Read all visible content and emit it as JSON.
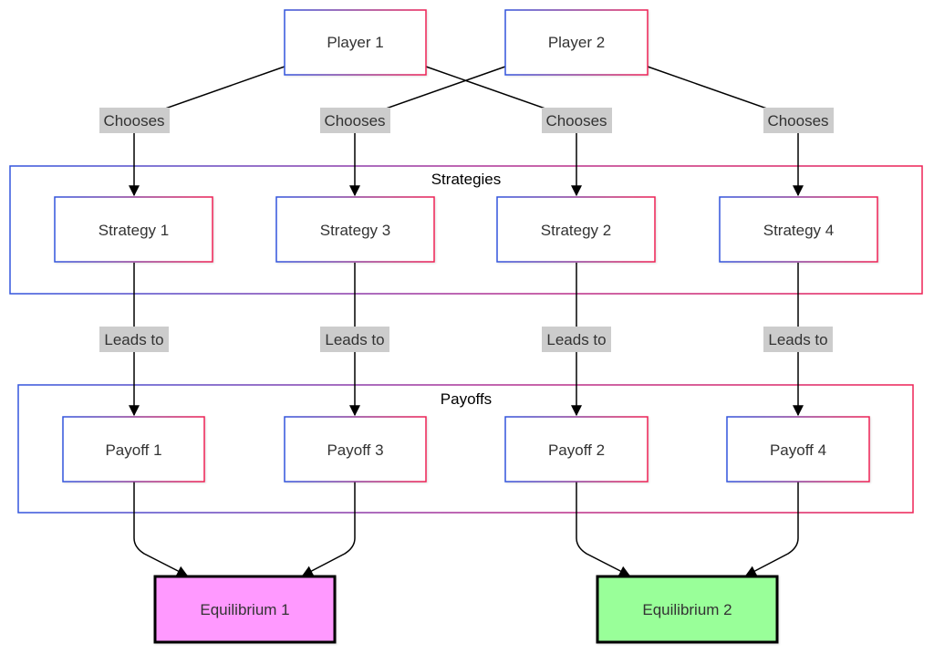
{
  "diagram": {
    "type": "flowchart",
    "colors": {
      "node_border_start": "#3355dd",
      "node_border_end": "#ee2255",
      "edge": "#000000",
      "edge_label_bg": "#cccccc",
      "equilibrium_1_fill": "#ff99ff",
      "equilibrium_2_fill": "#99ff99",
      "equilibrium_border": "#000000"
    },
    "players": [
      {
        "id": "p1",
        "label": "Player 1"
      },
      {
        "id": "p2",
        "label": "Player 2"
      }
    ],
    "clusters": {
      "strategies": {
        "title": "Strategies",
        "nodes": [
          {
            "id": "s1",
            "label": "Strategy 1"
          },
          {
            "id": "s3",
            "label": "Strategy 3"
          },
          {
            "id": "s2",
            "label": "Strategy 2"
          },
          {
            "id": "s4",
            "label": "Strategy 4"
          }
        ]
      },
      "payoffs": {
        "title": "Payoffs",
        "nodes": [
          {
            "id": "pay1",
            "label": "Payoff 1"
          },
          {
            "id": "pay3",
            "label": "Payoff 3"
          },
          {
            "id": "pay2",
            "label": "Payoff 2"
          },
          {
            "id": "pay4",
            "label": "Payoff 4"
          }
        ]
      }
    },
    "equilibria": [
      {
        "id": "e1",
        "label": "Equilibrium 1"
      },
      {
        "id": "e2",
        "label": "Equilibrium 2"
      }
    ],
    "edges": [
      {
        "from": "p1",
        "to": "s1",
        "label": "Chooses"
      },
      {
        "from": "p2",
        "to": "s3",
        "label": "Chooses"
      },
      {
        "from": "p1",
        "to": "s2",
        "label": "Chooses"
      },
      {
        "from": "p2",
        "to": "s4",
        "label": "Chooses"
      },
      {
        "from": "s1",
        "to": "pay1",
        "label": "Leads to"
      },
      {
        "from": "s3",
        "to": "pay3",
        "label": "Leads to"
      },
      {
        "from": "s2",
        "to": "pay2",
        "label": "Leads to"
      },
      {
        "from": "s4",
        "to": "pay4",
        "label": "Leads to"
      },
      {
        "from": "pay1",
        "to": "e1",
        "label": ""
      },
      {
        "from": "pay3",
        "to": "e1",
        "label": ""
      },
      {
        "from": "pay2",
        "to": "e2",
        "label": ""
      },
      {
        "from": "pay4",
        "to": "e2",
        "label": ""
      }
    ]
  }
}
